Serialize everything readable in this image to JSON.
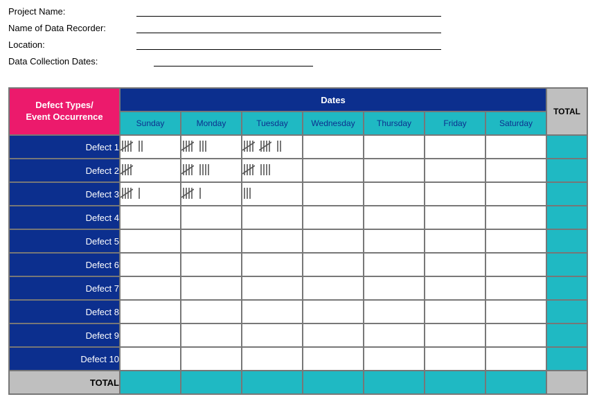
{
  "form": {
    "project_name_label": "Project Name:",
    "recorder_label": "Name of Data Recorder:",
    "location_label": "Location:",
    "dates_label": "Data Collection Dates:"
  },
  "table": {
    "corner_line1": "Defect Types/",
    "corner_line2": "Event Occurrence",
    "dates_header": "Dates",
    "total_header": "TOTAL",
    "days": [
      "Sunday",
      "Monday",
      "Tuesday",
      "Wednesday",
      "Thursday",
      "Friday",
      "Saturday"
    ],
    "rows": [
      {
        "label": "Defect 1",
        "values": [
          7,
          8,
          12,
          null,
          null,
          null,
          null
        ]
      },
      {
        "label": "Defect 2",
        "values": [
          5,
          9,
          9,
          null,
          null,
          null,
          null
        ]
      },
      {
        "label": "Defect 3",
        "values": [
          6,
          6,
          3,
          null,
          null,
          null,
          null
        ]
      },
      {
        "label": "Defect 4",
        "values": [
          null,
          null,
          null,
          null,
          null,
          null,
          null
        ]
      },
      {
        "label": "Defect 5",
        "values": [
          null,
          null,
          null,
          null,
          null,
          null,
          null
        ]
      },
      {
        "label": "Defect 6",
        "values": [
          null,
          null,
          null,
          null,
          null,
          null,
          null
        ]
      },
      {
        "label": "Defect 7",
        "values": [
          null,
          null,
          null,
          null,
          null,
          null,
          null
        ]
      },
      {
        "label": "Defect 8",
        "values": [
          null,
          null,
          null,
          null,
          null,
          null,
          null
        ]
      },
      {
        "label": "Defect 9",
        "values": [
          null,
          null,
          null,
          null,
          null,
          null,
          null
        ]
      },
      {
        "label": "Defect 10",
        "values": [
          null,
          null,
          null,
          null,
          null,
          null,
          null
        ]
      }
    ],
    "total_row_label": "TOTAL"
  },
  "chart_data": {
    "type": "table",
    "title": "Check Sheet - Defect Tally by Day",
    "columns": [
      "Sunday",
      "Monday",
      "Tuesday",
      "Wednesday",
      "Thursday",
      "Friday",
      "Saturday"
    ],
    "rows": [
      "Defect 1",
      "Defect 2",
      "Defect 3",
      "Defect 4",
      "Defect 5",
      "Defect 6",
      "Defect 7",
      "Defect 8",
      "Defect 9",
      "Defect 10"
    ],
    "values": [
      [
        7,
        8,
        12,
        null,
        null,
        null,
        null
      ],
      [
        5,
        9,
        9,
        null,
        null,
        null,
        null
      ],
      [
        6,
        6,
        3,
        null,
        null,
        null,
        null
      ],
      [
        null,
        null,
        null,
        null,
        null,
        null,
        null
      ],
      [
        null,
        null,
        null,
        null,
        null,
        null,
        null
      ],
      [
        null,
        null,
        null,
        null,
        null,
        null,
        null
      ],
      [
        null,
        null,
        null,
        null,
        null,
        null,
        null
      ],
      [
        null,
        null,
        null,
        null,
        null,
        null,
        null
      ],
      [
        null,
        null,
        null,
        null,
        null,
        null,
        null
      ],
      [
        null,
        null,
        null,
        null,
        null,
        null,
        null
      ]
    ]
  }
}
